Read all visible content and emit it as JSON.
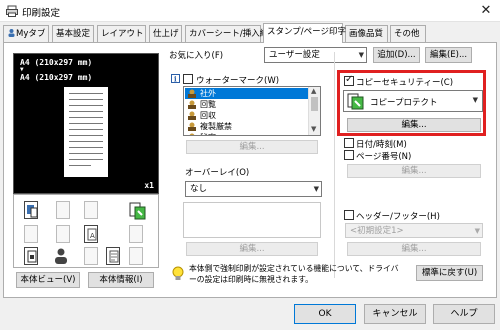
{
  "window": {
    "title": "印刷設定",
    "close_glyph": "✕"
  },
  "tabs": [
    {
      "label": "Myタブ"
    },
    {
      "label": "基本設定"
    },
    {
      "label": "レイアウト"
    },
    {
      "label": "仕上げ"
    },
    {
      "label": "カバーシート/挿入紙"
    },
    {
      "label": "スタンプ/ページ印字"
    },
    {
      "label": "画像品質"
    },
    {
      "label": "その他"
    }
  ],
  "preview": {
    "line1": "A4 (210x297 mm)",
    "arrow": "▼",
    "line2": "A4 (210x297 mm)",
    "copies": "x1"
  },
  "left_buttons": {
    "device_view": "本体ビュー(V)",
    "device_info": "本体情報(I)"
  },
  "favorites": {
    "label": "お気に入り(F)",
    "value": "ユーザー設定",
    "add_button": "追加(D)...",
    "edit_button": "編集(E)..."
  },
  "watermark": {
    "label": "ウォーターマーク(W)",
    "items": [
      "社外",
      "回覧",
      "回収",
      "複製厳禁",
      "秘密"
    ],
    "selected_index": 0,
    "edit_button": "編集..."
  },
  "overlay": {
    "label": "オーバーレイ(O)",
    "value": "なし",
    "edit_button": "編集..."
  },
  "copy_security": {
    "label": "コピーセキュリティー(C)",
    "value": "コピープロテクト",
    "edit_button": "編集..."
  },
  "date_time": {
    "label": "日付/時刻(M)"
  },
  "page_number": {
    "label": "ページ番号(N)",
    "edit_button": "編集..."
  },
  "header_footer": {
    "label": "ヘッダー/フッター(H)",
    "value": "<初期設定1>",
    "edit_button": "編集..."
  },
  "info_text": "本体側で強制印刷が設定されている機能について、ドライバーの設定は印刷時に無視されます。",
  "restore_button": "標準に戻す(U)",
  "dialog_buttons": {
    "ok": "OK",
    "cancel": "キャンセル",
    "help": "ヘルプ"
  },
  "colors": {
    "highlight": "#e02020",
    "selection": "#0078d7"
  },
  "icons": [
    "printer-icon",
    "person-icon",
    "mfp-icon",
    "info-bulb-icon",
    "copy-protect-icon",
    "watermark-item-icon"
  ]
}
